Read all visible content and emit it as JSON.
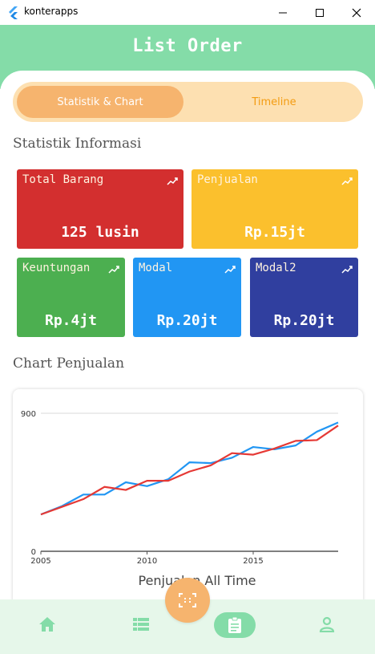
{
  "window": {
    "title": "konterapps"
  },
  "appbar": {
    "title": "List Order"
  },
  "tabs": [
    {
      "label": "Statistik & Chart",
      "active": true
    },
    {
      "label": "Timeline",
      "active": false
    }
  ],
  "sections": {
    "stats_title": "Statistik Informasi",
    "chart_title": "Chart Penjualan"
  },
  "cards": [
    {
      "label": "Total Barang",
      "value": "125 lusin",
      "color": "#d32f2f",
      "icon": "trending-up-icon"
    },
    {
      "label": "Penjualan",
      "value": "Rp.15jt",
      "color": "#fbc02d",
      "icon": "trending-up-icon"
    },
    {
      "label": "Keuntungan",
      "value": "Rp.4jt",
      "color": "#4caf50",
      "icon": "trending-up-icon"
    },
    {
      "label": "Modal",
      "value": "Rp.20jt",
      "color": "#2196f3",
      "icon": "trending-up-icon"
    },
    {
      "label": "Modal2",
      "value": "Rp.20jt",
      "color": "#303f9f",
      "icon": "trending-up-icon"
    }
  ],
  "chart_data": {
    "type": "line",
    "title": "Penjualan All Time",
    "xlabel": "",
    "ylabel": "",
    "xlim": [
      2005,
      2019
    ],
    "ylim": [
      0,
      900
    ],
    "x_ticks": [
      2005,
      2010,
      2015
    ],
    "y_ticks": [
      0,
      900
    ],
    "grid": "horizontal",
    "series": [
      {
        "color": "#2196f3",
        "x": [
          2005,
          2006,
          2007,
          2008,
          2009,
          2010,
          2011,
          2012,
          2013,
          2014,
          2015,
          2016,
          2017,
          2018,
          2019
        ],
        "values": [
          240,
          295,
          370,
          370,
          450,
          425,
          470,
          580,
          575,
          610,
          680,
          665,
          690,
          780,
          840
        ]
      },
      {
        "color": "#e53935",
        "x": [
          2005,
          2006,
          2007,
          2008,
          2009,
          2010,
          2011,
          2012,
          2013,
          2014,
          2015,
          2016,
          2017,
          2018,
          2019
        ],
        "values": [
          240,
          290,
          340,
          420,
          400,
          460,
          460,
          520,
          560,
          640,
          630,
          670,
          720,
          725,
          820
        ]
      }
    ]
  },
  "bottom_nav": {
    "items": [
      {
        "icon": "home-icon",
        "active": false
      },
      {
        "icon": "list-icon",
        "active": false
      },
      {
        "icon": "clipboard-icon",
        "active": true
      },
      {
        "icon": "person-icon",
        "active": false
      }
    ],
    "fab_icon": "scan-frame-icon"
  },
  "colors": {
    "primary_green": "#84dca8",
    "accent_orange": "#f6b46e",
    "tab_bg": "#fde0b1",
    "nav_bg": "#e6f7ea"
  }
}
